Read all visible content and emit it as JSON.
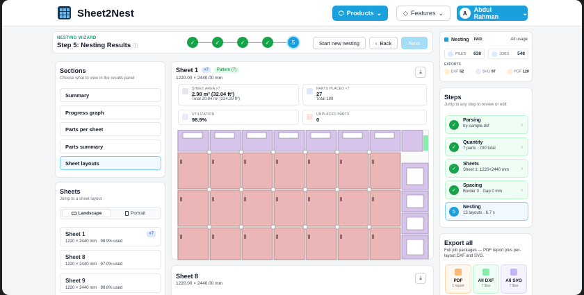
{
  "app": {
    "brand": "Sheet2Nest"
  },
  "topnav": {
    "products_label": "Products",
    "features_label": "Features",
    "user_initial": "A",
    "user_name": "Abdul Rahman"
  },
  "wizard": {
    "label": "NESTING WIZARD",
    "title": "Step 5: Nesting Results",
    "current_step": "5",
    "start_new_label": "Start new nesting",
    "back_label": "Back",
    "next_label": "Next"
  },
  "sections": {
    "title": "Sections",
    "subtitle": "Choose what to view in the results panel",
    "items": [
      "Summary",
      "Progress graph",
      "Parts per sheet",
      "Parts summary",
      "Sheet layouts"
    ],
    "active_index": 4
  },
  "sheets_panel": {
    "title": "Sheets",
    "subtitle": "Jump to a sheet layout",
    "orient_landscape": "Landscape",
    "orient_portrait": "Portrait",
    "items": [
      {
        "name": "Sheet 1",
        "meta": "1220 × 2440 mm · 98.9% used",
        "badge": "×7"
      },
      {
        "name": "Sheet 8",
        "meta": "1220 × 2440 mm · 97.0% used",
        "badge": ""
      },
      {
        "name": "Sheet 9",
        "meta": "1220 × 2440 mm · 99.8% used",
        "badge": ""
      }
    ]
  },
  "sheet1": {
    "title": "Sheet 1",
    "count_badge": "×7",
    "pattern_badge": "Pattern (7)",
    "dims": "1220.00 × 2440.00 mm",
    "stats": [
      {
        "label": "SHEET AREA ×7",
        "value": "2.98 m² (32.04 ft²)",
        "total": "Total 20.84 m² (224.29 ft²)"
      },
      {
        "label": "PARTS PLACED ×7",
        "value": "27",
        "total": "Total 189"
      },
      {
        "label": "UTILIZATION",
        "value": "98.9%",
        "total": ""
      },
      {
        "label": "UNPLACED PARTS",
        "value": "0",
        "total": ""
      }
    ]
  },
  "sheet8": {
    "title": "Sheet 8",
    "dims": "1220.00 × 2440.00 mm"
  },
  "usage": {
    "title": "Nesting",
    "plan_badge": "PAID",
    "all_usage_link": "All usage",
    "files_label": "FILES",
    "files_value": "638",
    "jobs_label": "JOBS",
    "jobs_value": "548",
    "exports_label": "EXPORTS",
    "dxf_label": "DXF",
    "dxf_value": "52",
    "svg_label": "SVG",
    "svg_value": "97",
    "pdf_label": "PDF",
    "pdf_value": "120"
  },
  "steps": {
    "title": "Steps",
    "subtitle": "Jump to any step to review or edit",
    "items": [
      {
        "name": "Parsing",
        "detail": "try-sample.dxf"
      },
      {
        "name": "Quantity",
        "detail": "7 parts · 700 total"
      },
      {
        "name": "Sheets",
        "detail": "Sheet 1: 1220×2440 mm"
      },
      {
        "name": "Spacing",
        "detail": "Border 0 · Gap 0 mm"
      },
      {
        "name": "Nesting",
        "detail": "13 layouts · 6.7 s",
        "number": "5"
      }
    ]
  },
  "export": {
    "title": "Export all",
    "desc": "Full job packages — PDF report plus per-layout DXF and SVG.",
    "buttons": [
      {
        "name": "PDF",
        "detail": "1 report"
      },
      {
        "name": "All DXF",
        "detail": "7 files"
      },
      {
        "name": "All SVG",
        "detail": "7 files"
      }
    ]
  },
  "colors": {
    "accent": "#1aa0dd",
    "success": "#16a34a",
    "part_red": "#e8b4b4",
    "part_purple": "#d8c4ea"
  },
  "icons": [
    "products-cube-icon",
    "chevron-down-icon",
    "info-icon",
    "check-icon",
    "chevron-left-icon",
    "download-icon",
    "landscape-icon",
    "portrait-icon",
    "chevron-right-icon",
    "pdf-icon",
    "dxf-icon",
    "svg-icon"
  ]
}
